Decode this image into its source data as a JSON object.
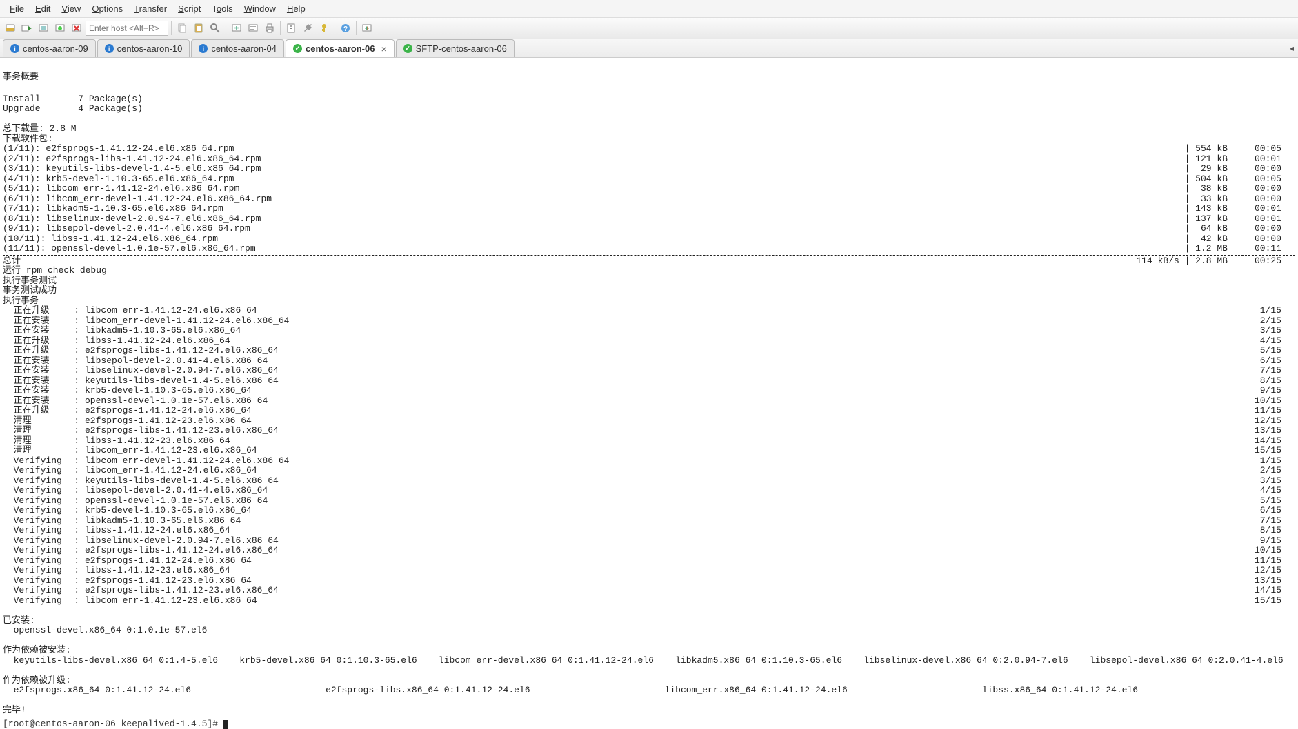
{
  "menu": {
    "file": "File",
    "edit": "Edit",
    "view": "View",
    "options": "Options",
    "transfer": "Transfer",
    "script": "Script",
    "tools": "Tools",
    "window": "Window",
    "help": "Help"
  },
  "toolbar": {
    "host_placeholder": "Enter host <Alt+R>"
  },
  "tabs": [
    {
      "label": "centos-aaron-09",
      "icon": "info",
      "active": false,
      "closable": false
    },
    {
      "label": "centos-aaron-10",
      "icon": "info",
      "active": false,
      "closable": false
    },
    {
      "label": "centos-aaron-04",
      "icon": "info",
      "active": false,
      "closable": false
    },
    {
      "label": "centos-aaron-06",
      "icon": "ok",
      "active": true,
      "closable": true
    },
    {
      "label": "SFTP-centos-aaron-06",
      "icon": "ok",
      "active": false,
      "closable": false
    }
  ],
  "term": {
    "header": "事务概要",
    "install": "Install       7 Package(s)",
    "upgrade": "Upgrade       4 Package(s)",
    "total_dl": "总下载量: 2.8 M",
    "dl_label": "下载软件包:",
    "dls": [
      {
        "l": "(1/11): e2fsprogs-1.41.12-24.el6.x86_64.rpm",
        "r": "| 554 kB     00:05"
      },
      {
        "l": "(2/11): e2fsprogs-libs-1.41.12-24.el6.x86_64.rpm",
        "r": "| 121 kB     00:01"
      },
      {
        "l": "(3/11): keyutils-libs-devel-1.4-5.el6.x86_64.rpm",
        "r": "|  29 kB     00:00"
      },
      {
        "l": "(4/11): krb5-devel-1.10.3-65.el6.x86_64.rpm",
        "r": "| 504 kB     00:05"
      },
      {
        "l": "(5/11): libcom_err-1.41.12-24.el6.x86_64.rpm",
        "r": "|  38 kB     00:00"
      },
      {
        "l": "(6/11): libcom_err-devel-1.41.12-24.el6.x86_64.rpm",
        "r": "|  33 kB     00:00"
      },
      {
        "l": "(7/11): libkadm5-1.10.3-65.el6.x86_64.rpm",
        "r": "| 143 kB     00:01"
      },
      {
        "l": "(8/11): libselinux-devel-2.0.94-7.el6.x86_64.rpm",
        "r": "| 137 kB     00:01"
      },
      {
        "l": "(9/11): libsepol-devel-2.0.41-4.el6.x86_64.rpm",
        "r": "|  64 kB     00:00"
      },
      {
        "l": "(10/11): libss-1.41.12-24.el6.x86_64.rpm",
        "r": "|  42 kB     00:00"
      },
      {
        "l": "(11/11): openssl-devel-1.0.1e-57.el6.x86_64.rpm",
        "r": "| 1.2 MB     00:11"
      }
    ],
    "total_line": {
      "l": "总计",
      "r": "114 kB/s | 2.8 MB     00:25"
    },
    "rpm_check": "运行 rpm_check_debug",
    "run_test": "执行事务测试",
    "test_ok": "事务测试成功",
    "run_tx": "执行事务",
    "actions": [
      {
        "a": "  正在升级",
        "p": ": libcom_err-1.41.12-24.el6.x86_64",
        "n": "1/15"
      },
      {
        "a": "  正在安装",
        "p": ": libcom_err-devel-1.41.12-24.el6.x86_64",
        "n": "2/15"
      },
      {
        "a": "  正在安装",
        "p": ": libkadm5-1.10.3-65.el6.x86_64",
        "n": "3/15"
      },
      {
        "a": "  正在升级",
        "p": ": libss-1.41.12-24.el6.x86_64",
        "n": "4/15"
      },
      {
        "a": "  正在升级",
        "p": ": e2fsprogs-libs-1.41.12-24.el6.x86_64",
        "n": "5/15"
      },
      {
        "a": "  正在安装",
        "p": ": libsepol-devel-2.0.41-4.el6.x86_64",
        "n": "6/15"
      },
      {
        "a": "  正在安装",
        "p": ": libselinux-devel-2.0.94-7.el6.x86_64",
        "n": "7/15"
      },
      {
        "a": "  正在安装",
        "p": ": keyutils-libs-devel-1.4-5.el6.x86_64",
        "n": "8/15"
      },
      {
        "a": "  正在安装",
        "p": ": krb5-devel-1.10.3-65.el6.x86_64",
        "n": "9/15"
      },
      {
        "a": "  正在安装",
        "p": ": openssl-devel-1.0.1e-57.el6.x86_64",
        "n": "10/15"
      },
      {
        "a": "  正在升级",
        "p": ": e2fsprogs-1.41.12-24.el6.x86_64",
        "n": "11/15"
      },
      {
        "a": "  清理",
        "p": ": e2fsprogs-1.41.12-23.el6.x86_64",
        "n": "12/15"
      },
      {
        "a": "  清理",
        "p": ": e2fsprogs-libs-1.41.12-23.el6.x86_64",
        "n": "13/15"
      },
      {
        "a": "  清理",
        "p": ": libss-1.41.12-23.el6.x86_64",
        "n": "14/15"
      },
      {
        "a": "  清理",
        "p": ": libcom_err-1.41.12-23.el6.x86_64",
        "n": "15/15"
      },
      {
        "a": "  Verifying",
        "p": ": libcom_err-devel-1.41.12-24.el6.x86_64",
        "n": "1/15"
      },
      {
        "a": "  Verifying",
        "p": ": libcom_err-1.41.12-24.el6.x86_64",
        "n": "2/15"
      },
      {
        "a": "  Verifying",
        "p": ": keyutils-libs-devel-1.4-5.el6.x86_64",
        "n": "3/15"
      },
      {
        "a": "  Verifying",
        "p": ": libsepol-devel-2.0.41-4.el6.x86_64",
        "n": "4/15"
      },
      {
        "a": "  Verifying",
        "p": ": openssl-devel-1.0.1e-57.el6.x86_64",
        "n": "5/15"
      },
      {
        "a": "  Verifying",
        "p": ": krb5-devel-1.10.3-65.el6.x86_64",
        "n": "6/15"
      },
      {
        "a": "  Verifying",
        "p": ": libkadm5-1.10.3-65.el6.x86_64",
        "n": "7/15"
      },
      {
        "a": "  Verifying",
        "p": ": libss-1.41.12-24.el6.x86_64",
        "n": "8/15"
      },
      {
        "a": "  Verifying",
        "p": ": libselinux-devel-2.0.94-7.el6.x86_64",
        "n": "9/15"
      },
      {
        "a": "  Verifying",
        "p": ": e2fsprogs-libs-1.41.12-24.el6.x86_64",
        "n": "10/15"
      },
      {
        "a": "  Verifying",
        "p": ": e2fsprogs-1.41.12-24.el6.x86_64",
        "n": "11/15"
      },
      {
        "a": "  Verifying",
        "p": ": libss-1.41.12-23.el6.x86_64",
        "n": "12/15"
      },
      {
        "a": "  Verifying",
        "p": ": e2fsprogs-1.41.12-23.el6.x86_64",
        "n": "13/15"
      },
      {
        "a": "  Verifying",
        "p": ": e2fsprogs-libs-1.41.12-23.el6.x86_64",
        "n": "14/15"
      },
      {
        "a": "  Verifying",
        "p": ": libcom_err-1.41.12-23.el6.x86_64",
        "n": "15/15"
      }
    ],
    "installed_hdr": "已安装:",
    "installed": "  openssl-devel.x86_64 0:1.0.1e-57.el6",
    "dep_install_hdr": "作为依赖被安装:",
    "dep_install": "  keyutils-libs-devel.x86_64 0:1.4-5.el6    krb5-devel.x86_64 0:1.10.3-65.el6    libcom_err-devel.x86_64 0:1.41.12-24.el6    libkadm5.x86_64 0:1.10.3-65.el6    libselinux-devel.x86_64 0:2.0.94-7.el6    libsepol-devel.x86_64 0:2.0.41-4.el6",
    "dep_upgrade_hdr": "作为依赖被升级:",
    "dep_upgrade": "  e2fsprogs.x86_64 0:1.41.12-24.el6                         e2fsprogs-libs.x86_64 0:1.41.12-24.el6                         libcom_err.x86_64 0:1.41.12-24.el6                         libss.x86_64 0:1.41.12-24.el6",
    "done": "完毕!",
    "prompt": "[root@centos-aaron-06 keepalived-1.4.5]#"
  }
}
